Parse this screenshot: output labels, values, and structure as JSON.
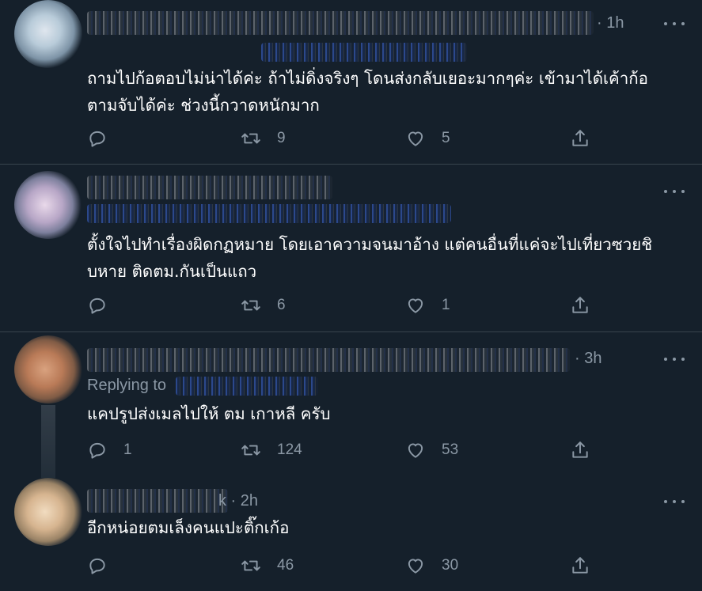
{
  "tweets": [
    {
      "time": "· 1h",
      "text": "ถามไปก้อตอบไม่น่าได้ค่ะ ถ้าไม่ดิ่งจริงๆ โดนส่งกลับเยอะมากๆค่ะ เข้ามาได้เค้าก้อ\nตามจับได้ค่ะ ช่วงนี้กวาดหนักมาก",
      "replies": "",
      "retweets": "9",
      "likes": "5"
    },
    {
      "time": "",
      "text": "ตั้งใจไปทำเรื่องผิดกฏหมาย โดยเอาความจนมาอ้าง แต่คนอื่นที่แค่จะไปเที่ยวซวยชิ\nบหาย ติดตม.กันเป็นแถว",
      "replies": "",
      "retweets": "6",
      "likes": "1"
    },
    {
      "time": "· 3h",
      "replying_label": "Replying to",
      "text": "แคปรูปส่งเมลไปให้ ตม เกาหลี ครับ",
      "replies": "1",
      "retweets": "124",
      "likes": "53"
    },
    {
      "time": "k · 2h",
      "text": "อีกหน่อยตมเล็งคนแปะติ๊กเก้อ",
      "replies": "",
      "retweets": "46",
      "likes": "30"
    }
  ],
  "icons": {
    "reply": "reply-icon",
    "retweet": "retweet-icon",
    "like": "like-icon",
    "share": "share-icon",
    "more": "more-icon"
  },
  "colors": {
    "background": "#15202b",
    "secondary_text": "#8b98a5",
    "divider": "#38444d"
  }
}
